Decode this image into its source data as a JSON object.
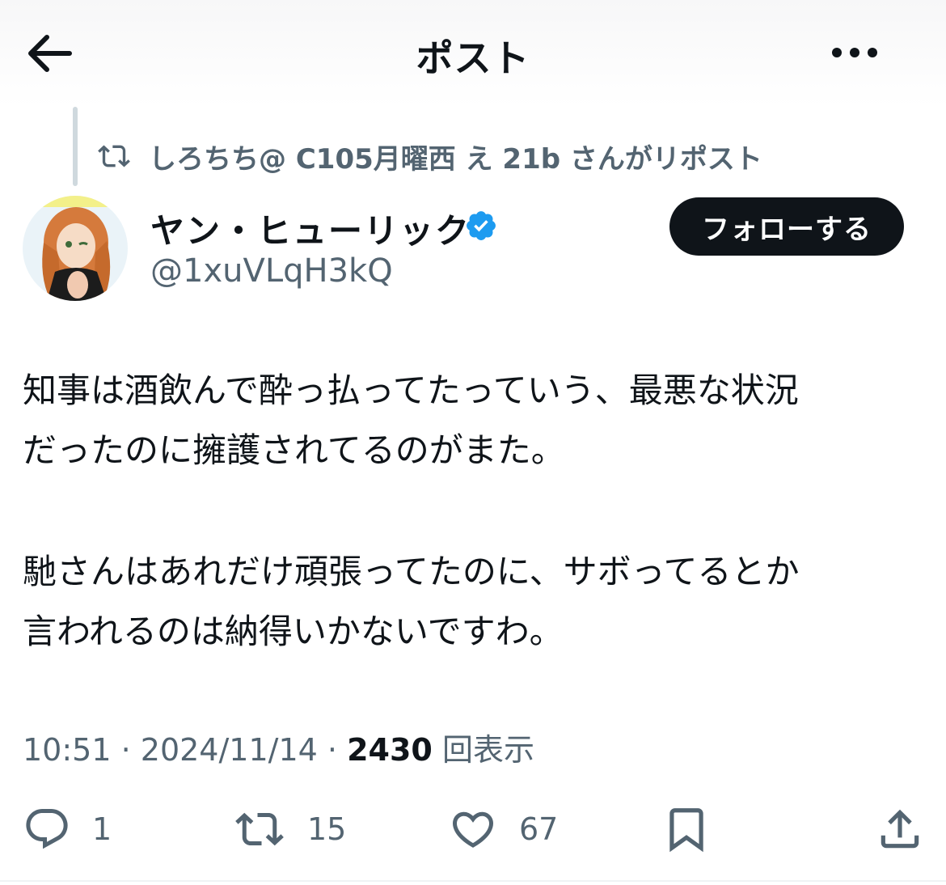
{
  "header": {
    "title": "ポスト",
    "back_icon": "arrow-left-icon",
    "more_icon": "more-horizontal-icon"
  },
  "repost": {
    "text": "しろちち@ C105月曜西 え 21b さんがリポスト",
    "icon": "repost-icon"
  },
  "author": {
    "display_name": "ヤン・ヒューリック",
    "handle": "@1xuVLqH3kQ",
    "verified": true,
    "verified_color": "#1d9bf0"
  },
  "follow_button": {
    "label": "フォローする"
  },
  "post": {
    "lines": [
      "知事は酒飲んで酔っ払ってたっていう、最悪な状況",
      "だったのに擁護されてるのがまた。",
      "馳さんはあれだけ頑張ってたのに、サボってるとか",
      "言われるのは納得いかないですわ。"
    ]
  },
  "meta": {
    "time": "10:51",
    "date": "2024/11/14",
    "views": "2430",
    "views_label": "回表示"
  },
  "actions": {
    "replies": "1",
    "reposts": "15",
    "likes": "67"
  },
  "colors": {
    "text": "#0f1419",
    "secondary": "#536471",
    "button_bg": "#0f1419"
  }
}
